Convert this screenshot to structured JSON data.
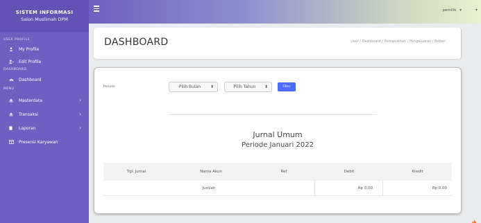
{
  "brand": {
    "title": "SISTEM INFORMASI",
    "subtitle": "Salon Muslimah DPM"
  },
  "sidebar": {
    "sections": [
      {
        "heading": "USER PROFILE"
      },
      {
        "heading": "DASHBOARD"
      },
      {
        "heading": "MENU"
      }
    ],
    "items": [
      {
        "label": "My Profile",
        "icon": "user-icon"
      },
      {
        "label": "Edit Profile",
        "icon": "user-edit-icon"
      },
      {
        "label": "Dashboard",
        "icon": "dashboard-icon"
      },
      {
        "label": "Masterdata",
        "icon": "eject-icon",
        "chevron": "›"
      },
      {
        "label": "Transaksi",
        "icon": "eject-icon",
        "chevron": "›"
      },
      {
        "label": "Laporan",
        "icon": "file-icon",
        "chevron": "›"
      },
      {
        "label": "Presensi Karyawan",
        "icon": "table-icon"
      }
    ]
  },
  "topbar": {
    "user_label": "pemilik",
    "caret": "▾"
  },
  "header": {
    "title": "DASHBOARD",
    "breadcrumb": "User / Dashboard / Pemasukkan / Pengeluaran / Beban"
  },
  "filter": {
    "periode_label": "Periode",
    "bulan_label": "Pilih Bulan",
    "tahun_label": "Pilih Tahun",
    "button_label": "Filter"
  },
  "report": {
    "title": "Jurnal Umum",
    "subtitle": "Periode Januari 2022"
  },
  "table": {
    "headers": [
      "Tgl. Jurnal",
      "Nama Akun",
      "Ref",
      "Debit",
      "Kredit"
    ],
    "total_label": "Jumlah",
    "total_debit": "Rp 0,00",
    "total_kredit": "Rp 0,00"
  },
  "colors": {
    "sidebar": "#6f5fc0",
    "brand": "#6352b3",
    "filter_button": "#4d6bff"
  }
}
